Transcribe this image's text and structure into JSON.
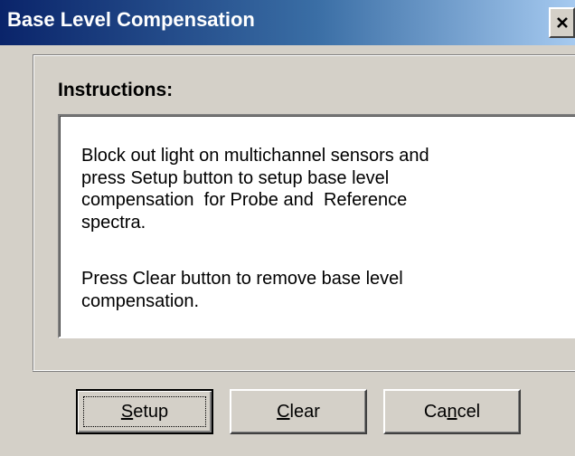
{
  "window": {
    "title": "Base Level Compensation",
    "close_glyph": "✕"
  },
  "group": {
    "label": "Instructions:"
  },
  "instructions": {
    "paragraph1_lines": [
      "Block out light on multichannel sensors and",
      "press Setup button to setup base level",
      "compensation  for Probe and  Reference",
      "spectra."
    ],
    "paragraph2_lines": [
      "Press Clear button to remove base level",
      "compensation."
    ]
  },
  "buttons": {
    "setup": {
      "pre": "",
      "mnemonic": "S",
      "post": "etup"
    },
    "clear": {
      "pre": "",
      "mnemonic": "C",
      "post": "lear"
    },
    "cancel": {
      "pre": "Ca",
      "mnemonic": "n",
      "post": "cel"
    }
  },
  "colors": {
    "face": "#d4d0c8",
    "title_start": "#0a246a",
    "title_end": "#a6caf0"
  }
}
